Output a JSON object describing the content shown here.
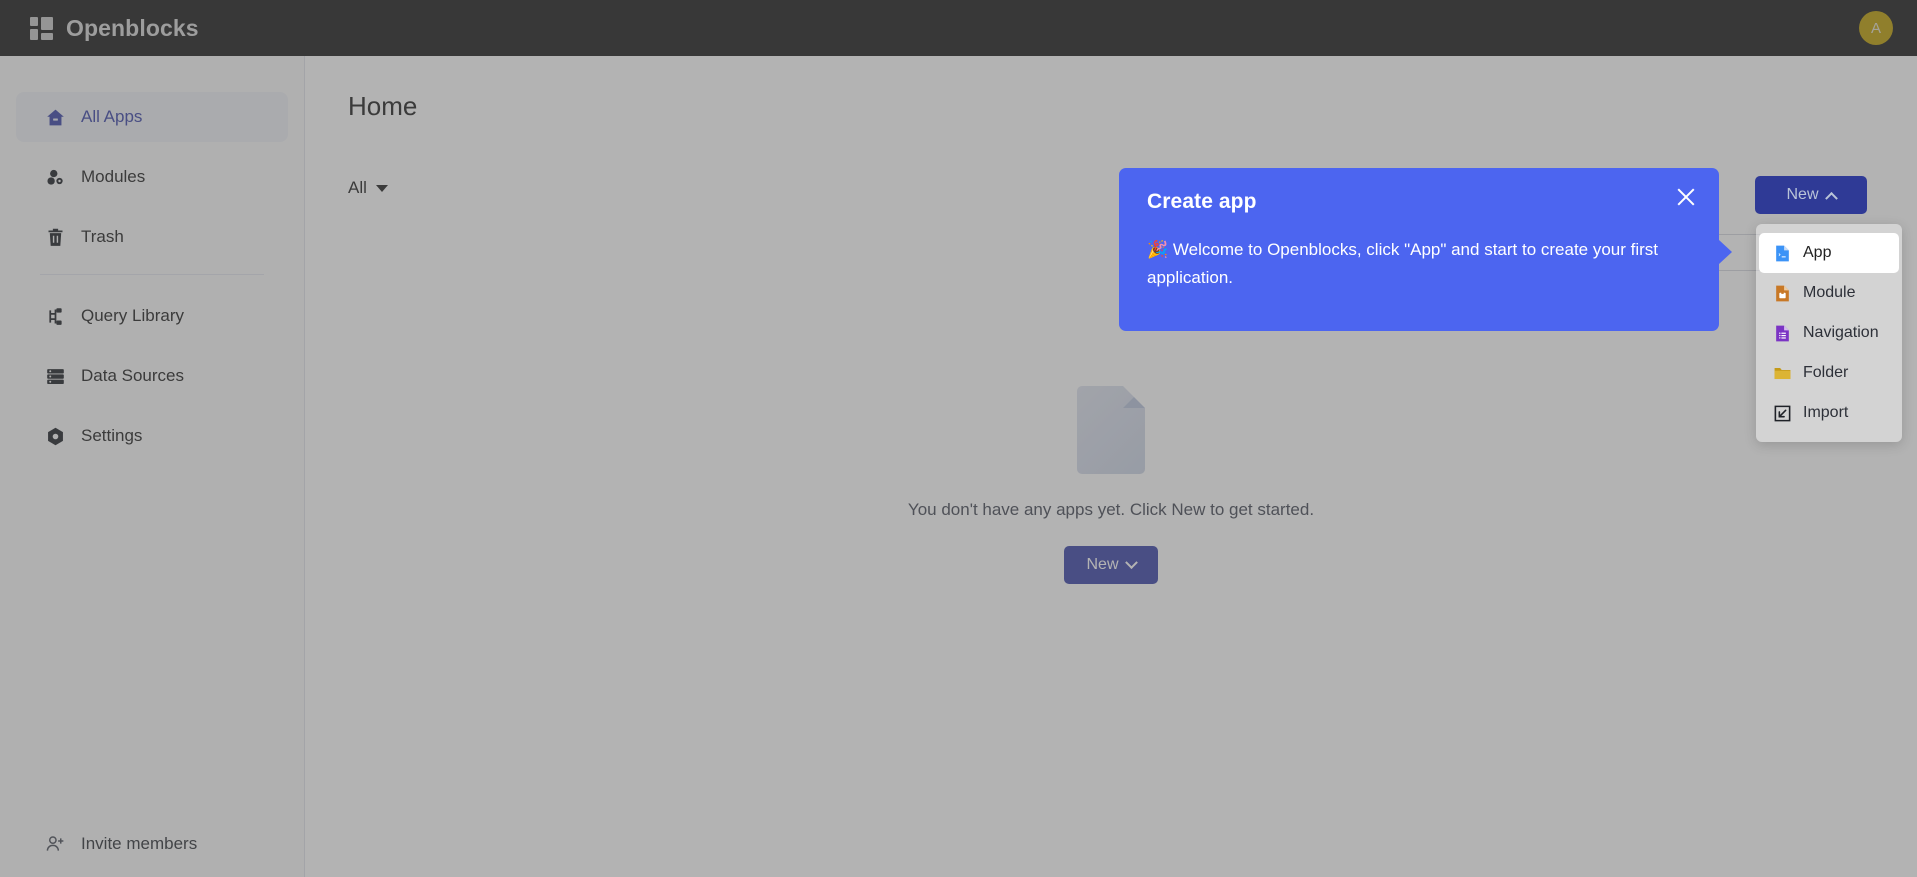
{
  "topbar": {
    "brand_name": "Openblocks",
    "logo_icon": "grid-logo-icon",
    "avatar_initial": "A"
  },
  "sidebar": {
    "items": [
      {
        "label": "All Apps",
        "icon": "home-icon",
        "active": true
      },
      {
        "label": "Modules",
        "icon": "modules-icon",
        "active": false
      },
      {
        "label": "Trash",
        "icon": "trash-icon",
        "active": false
      },
      {
        "label": "Query Library",
        "icon": "query-icon",
        "active": false
      },
      {
        "label": "Data Sources",
        "icon": "database-icon",
        "active": false
      },
      {
        "label": "Settings",
        "icon": "gear-icon",
        "active": false
      }
    ],
    "divider_after_index": 2,
    "invite": {
      "label": "Invite members",
      "icon": "user-plus-icon"
    }
  },
  "main": {
    "page_title": "Home",
    "filter": {
      "label": "All",
      "icon": "caret-down-icon"
    },
    "search": {
      "value": "",
      "placeholder": ""
    },
    "empty_state": {
      "icon": "empty-document-icon",
      "text": "You don't have any apps yet. Click New to get started.",
      "button_label": "New",
      "button_icon": "chevron-down-icon"
    }
  },
  "new_button_top": {
    "label": "New",
    "icon": "chevron-up-icon"
  },
  "dropdown": {
    "items": [
      {
        "label": "App",
        "icon": "app-file-icon",
        "highlighted": true
      },
      {
        "label": "Module",
        "icon": "module-file-icon",
        "highlighted": false
      },
      {
        "label": "Navigation",
        "icon": "navigation-file-icon",
        "highlighted": false
      },
      {
        "label": "Folder",
        "icon": "folder-icon",
        "highlighted": false
      },
      {
        "label": "Import",
        "icon": "import-icon",
        "highlighted": false
      }
    ]
  },
  "tooltip": {
    "title": "Create app",
    "emoji": "🎉",
    "body": "Welcome to Openblocks, click \"App\" and start to create your first application.",
    "close_icon": "close-icon"
  },
  "colors": {
    "brand_dark": "#1c1c1c",
    "accent_indigo": "#3b45a8",
    "tooltip_blue": "#4c65f0",
    "avatar_gold": "#bfa006",
    "app_icon_blue": "#3b93f7",
    "module_icon_orange": "#c87826",
    "navigation_icon_purple": "#7b34c4",
    "folder_icon_gold": "#c49a18"
  }
}
